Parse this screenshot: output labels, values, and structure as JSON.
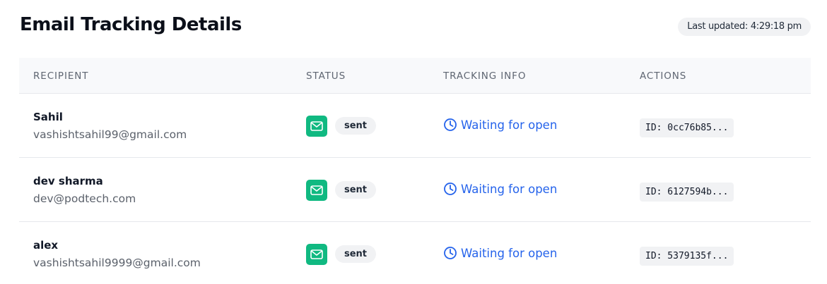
{
  "header": {
    "title": "Email Tracking Details",
    "last_updated": "Last updated: 4:29:18 pm"
  },
  "table": {
    "columns": [
      "RECIPIENT",
      "STATUS",
      "TRACKING INFO",
      "ACTIONS"
    ],
    "rows": [
      {
        "name": "Sahil",
        "email": "vashishtsahil99@gmail.com",
        "status_icon": "mail-icon",
        "status": "sent",
        "tracking_icon": "clock-icon",
        "tracking": "Waiting for open",
        "id": "ID: 0cc76b85..."
      },
      {
        "name": "dev sharma",
        "email": "dev@podtech.com",
        "status_icon": "mail-icon",
        "status": "sent",
        "tracking_icon": "clock-icon",
        "tracking": "Waiting for open",
        "id": "ID: 6127594b..."
      },
      {
        "name": "alex",
        "email": "vashishtsahil9999@gmail.com",
        "status_icon": "mail-icon",
        "status": "sent",
        "tracking_icon": "clock-icon",
        "tracking": "Waiting for open",
        "id": "ID: 5379135f..."
      }
    ]
  },
  "colors": {
    "status_icon_bg": "#10b981",
    "tracking_text": "#2563eb",
    "badge_bg": "#f1f2f4",
    "header_bg": "#f8f9fb"
  }
}
